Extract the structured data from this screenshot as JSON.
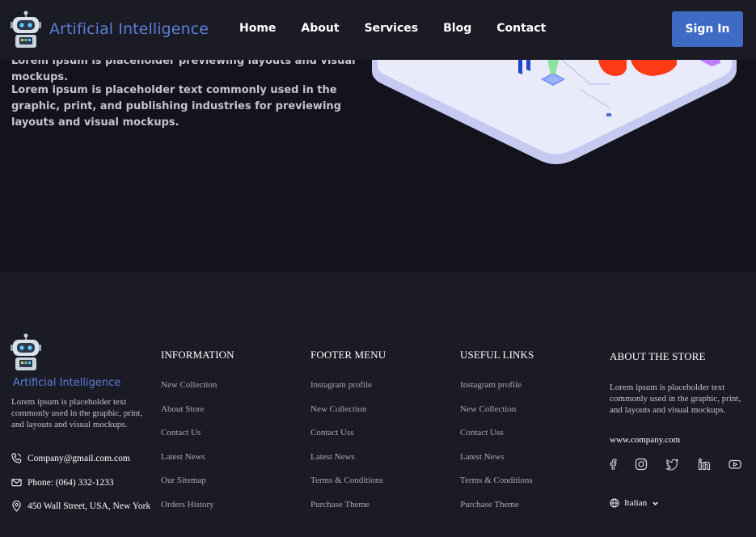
{
  "header": {
    "brand": "Artificial Intelligence",
    "logo_icon": "robot-icon",
    "nav": [
      "Home",
      "About",
      "Services",
      "Blog",
      "Contact"
    ],
    "signin_label": "Sign In"
  },
  "hero": {
    "paragraph_1": "Lorem ipsum is placeholder previewing layouts and visual mockups.",
    "paragraph_2": "Lorem ipsum is placeholder text commonly used in the graphic, print, and publishing industries for previewing layouts and visual mockups."
  },
  "footer": {
    "brand": "Artificial Intelligence",
    "about": "Lorem ipsum is placeholder text commonly used in the graphic, print, and layouts and visual mockups.",
    "email": "Company@gmail.com.com",
    "phone": "Phone: (064) 332-1233",
    "address": "450 Wall Street, USA, New York",
    "information": {
      "title": "INFORMATION",
      "links": [
        "New Collection",
        "About Store",
        "Contact Us",
        "Latest News",
        "Our Sitemap",
        "Orders History"
      ]
    },
    "footer_menu": {
      "title": "FOOTER MENU",
      "links": [
        "Instagram profile",
        "New Collection",
        "Contact Uss",
        "Latest News",
        "Terms & Conditions",
        "Purchase Theme"
      ]
    },
    "useful_links": {
      "title": "USEFUL LINKS",
      "links": [
        "Instagram profile",
        "New Collection",
        "Contact Uss",
        "Latest News",
        "Terms & Conditions",
        "Purchase Theme"
      ]
    },
    "about_store": {
      "title": "ABOUT THE STORE",
      "text": "Lorem ipsum is placeholder text commonly used in the graphic, print, and layouts and visual mockups.",
      "url": "www.company.com"
    },
    "social_icons": [
      "facebook-icon",
      "instagram-icon",
      "twitter-icon",
      "linkedin-icon",
      "youtube-icon"
    ],
    "language": "Italian"
  },
  "colors": {
    "accent": "#3f6bc5",
    "brand_text": "#5a7fd6",
    "page_bg": "#13121d",
    "panel_bg": "#1b1b26"
  }
}
